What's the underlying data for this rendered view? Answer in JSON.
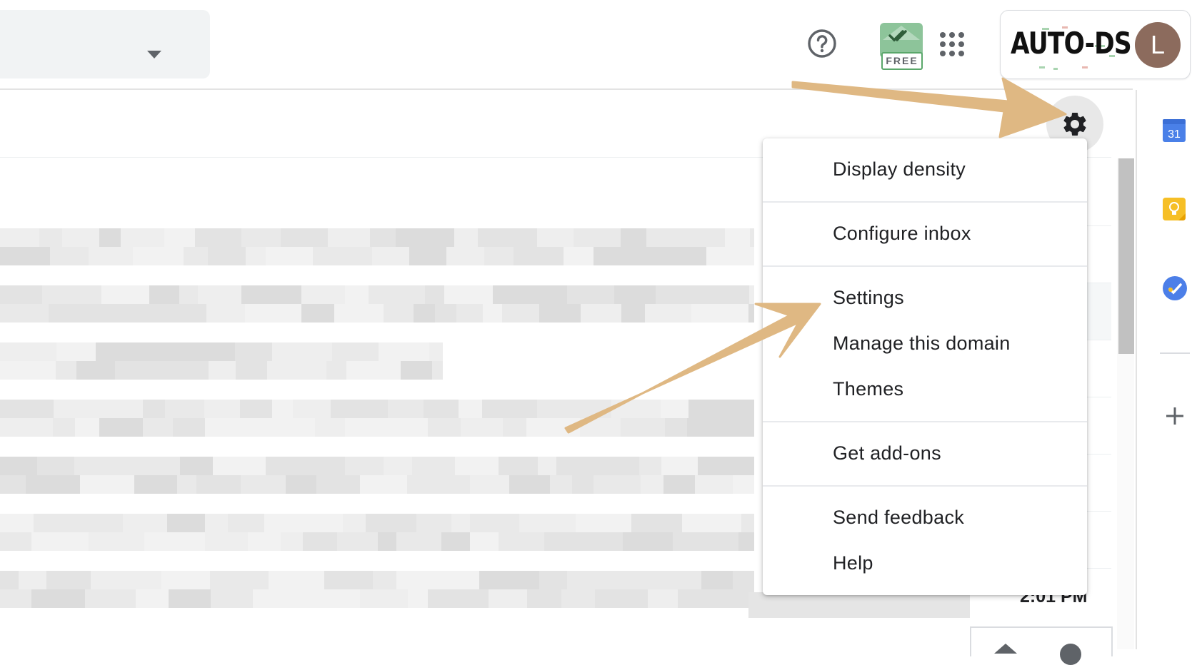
{
  "header": {
    "search_dropdown_icon": "caret-down-icon",
    "help_icon": "help-circle-icon",
    "addon": {
      "badge_label": "FREE",
      "icon": "mailtrack-envelope-icon"
    },
    "apps_icon": "apps-grid-icon",
    "account": {
      "org_logo_text": "AUTO-DS",
      "avatar_initial": "L",
      "avatar_color": "#8c6b5d"
    }
  },
  "toolbar": {
    "settings_icon": "gear-icon"
  },
  "settings_menu": {
    "items": [
      {
        "label": "Display density"
      },
      {
        "label": "Configure inbox"
      },
      {
        "label": "Settings"
      },
      {
        "label": "Manage this domain"
      },
      {
        "label": "Themes"
      },
      {
        "label": "Get add-ons"
      },
      {
        "label": "Send feedback"
      },
      {
        "label": "Help"
      }
    ]
  },
  "message_list": {
    "visible_time": "2:01 PM"
  },
  "side_panel": {
    "calendar": {
      "icon": "calendar-icon",
      "day": "31"
    },
    "keep_icon": "keep-lightbulb-icon",
    "tasks_icon": "tasks-check-icon",
    "add_icon": "plus-icon"
  },
  "colors": {
    "annotation_arrow": "#dfb883",
    "calendar_blue": "#4a80e8",
    "keep_yellow": "#f6bf26",
    "tasks_blue": "#4c7fe8"
  }
}
